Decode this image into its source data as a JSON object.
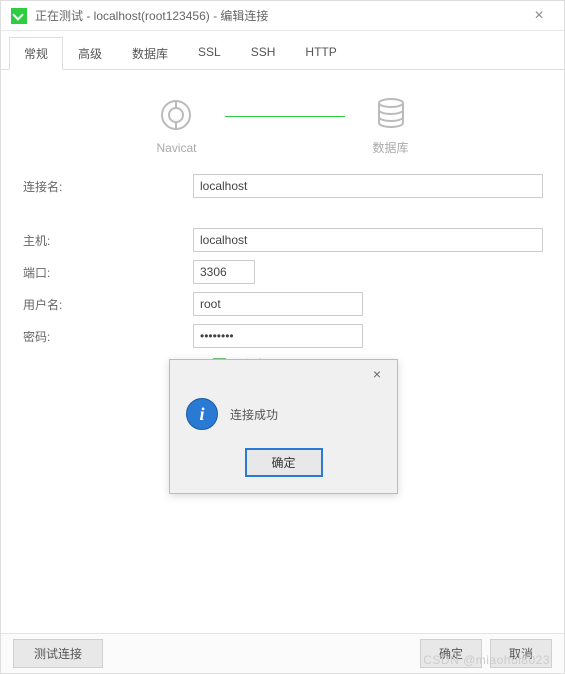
{
  "title": "正在测试 - localhost(root123456) - 编辑连接",
  "tabs": [
    "常规",
    "高级",
    "数据库",
    "SSL",
    "SSH",
    "HTTP"
  ],
  "diagram": {
    "left": "Navicat",
    "right": "数据库"
  },
  "labels": {
    "conn_name": "连接名:",
    "host": "主机:",
    "port": "端口:",
    "user": "用户名:",
    "pass": "密码:",
    "save_pass": "保存密码"
  },
  "values": {
    "conn_name": "localhost",
    "host": "localhost",
    "port": "3306",
    "user": "root",
    "pass": "••••••••"
  },
  "buttons": {
    "test": "测试连接",
    "ok": "确定",
    "cancel": "取消"
  },
  "dialog": {
    "message": "连接成功",
    "ok": "确定"
  },
  "watermark": "CSDN @miaohui8023"
}
